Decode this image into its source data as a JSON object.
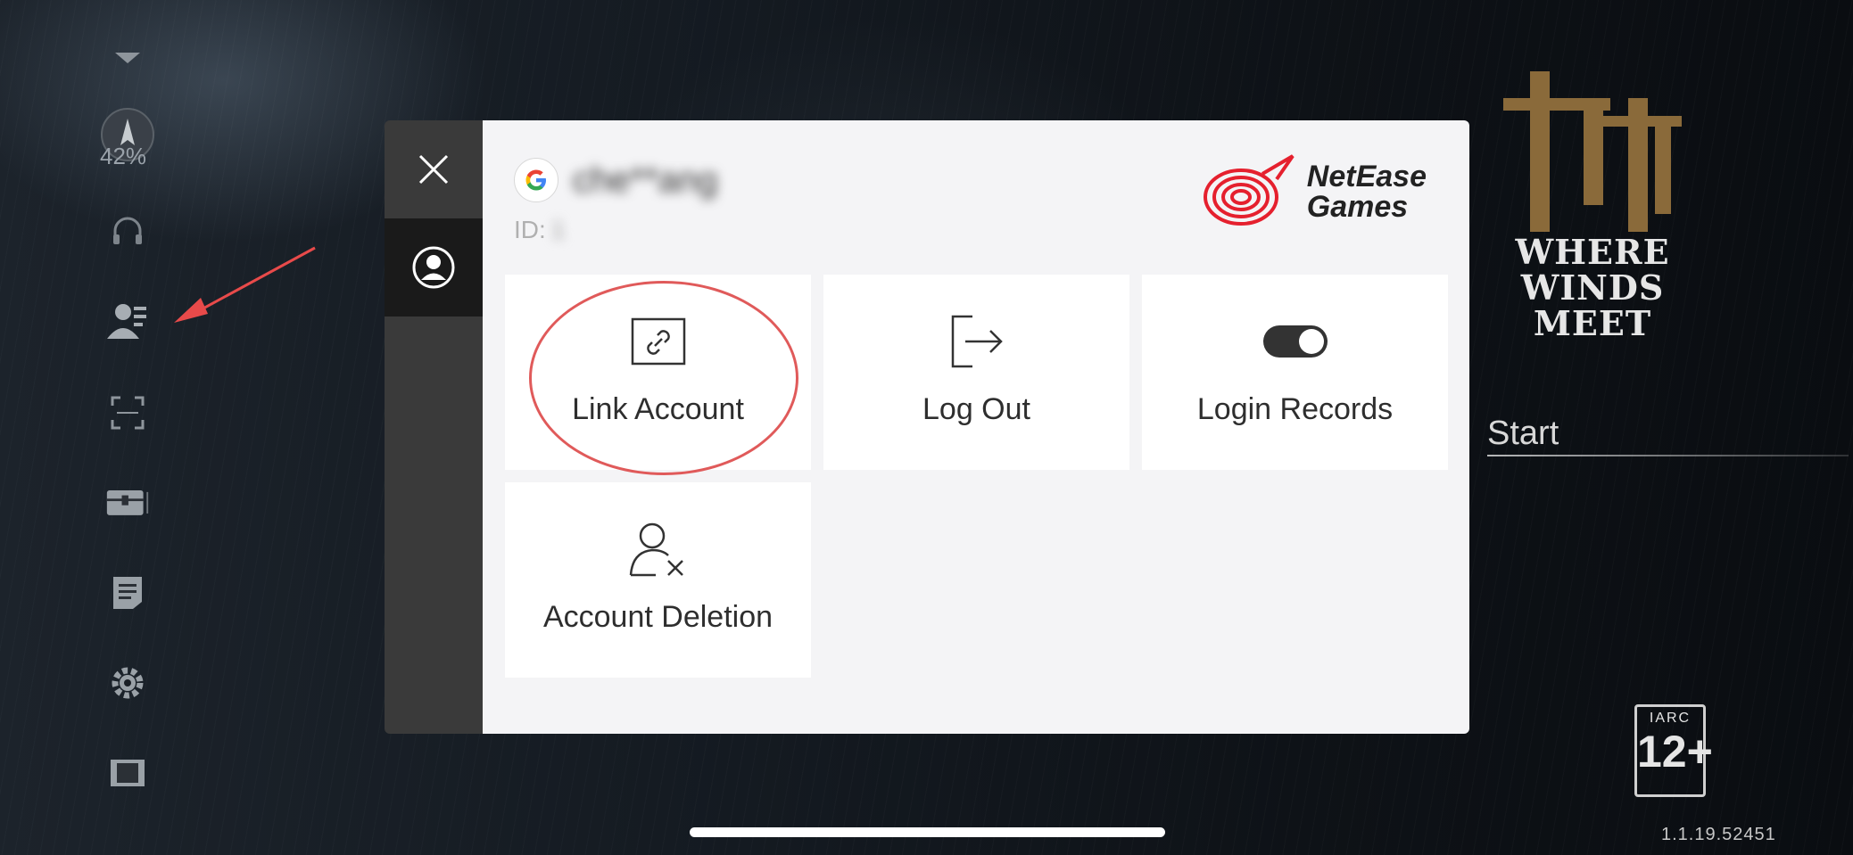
{
  "sidebar": {
    "progress": "42%",
    "items": [
      {
        "name": "collapse-arrow-icon"
      },
      {
        "name": "progress-icon"
      },
      {
        "name": "headset-icon"
      },
      {
        "name": "account-icon"
      },
      {
        "name": "scan-icon"
      },
      {
        "name": "chest-icon"
      },
      {
        "name": "notes-icon"
      },
      {
        "name": "settings-icon"
      },
      {
        "name": "screen-icon"
      }
    ]
  },
  "modal": {
    "account": {
      "provider_icon": "google-icon",
      "username": "che**ang",
      "id_label": "ID:",
      "id_value": "1"
    },
    "brand": {
      "line1": "NetEase",
      "line2": "Games",
      "color": "#e5202e"
    },
    "options": [
      {
        "label": "Link Account",
        "icon": "link-icon"
      },
      {
        "label": "Log Out",
        "icon": "logout-icon"
      },
      {
        "label": "Login Records",
        "icon": "toggle-icon"
      },
      {
        "label": "Account Deletion",
        "icon": "user-remove-icon"
      }
    ],
    "highlight_color": "#e05a5a"
  },
  "game": {
    "logo_line1": "WHERE",
    "logo_line2": "WINDS MEET",
    "start": "Start",
    "rating_org": "IARC",
    "rating_age": "12+",
    "version": "1.1.19.52451"
  }
}
